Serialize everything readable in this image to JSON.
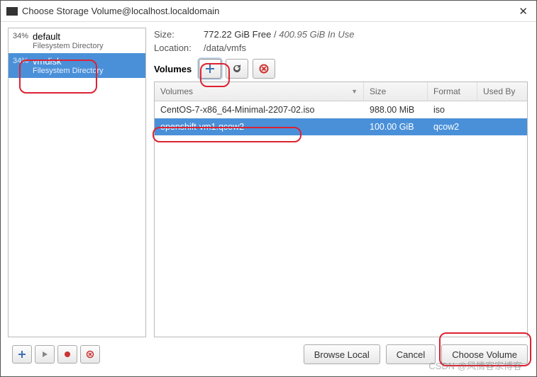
{
  "window": {
    "title": "Choose Storage Volume@localhost.localdomain"
  },
  "pools": [
    {
      "pct": "34%",
      "name": "default",
      "type": "Filesystem Directory"
    },
    {
      "pct": "34%",
      "name": "vmdisk",
      "type": "Filesystem Directory"
    }
  ],
  "info": {
    "size_label": "Size:",
    "size_free": "772.22 GiB Free",
    "size_sep": " / ",
    "size_inuse": "400.95 GiB In Use",
    "location_label": "Location:",
    "location": "/data/vmfs",
    "volumes_label": "Volumes"
  },
  "table": {
    "headers": {
      "name": "Volumes",
      "size": "Size",
      "format": "Format",
      "used": "Used By"
    },
    "rows": [
      {
        "name": "CentOS-7-x86_64-Minimal-2207-02.iso",
        "size": "988.00 MiB",
        "format": "iso",
        "used": ""
      },
      {
        "name": "openshift-vm1.qcow2",
        "size": "100.00 GiB",
        "format": "qcow2",
        "used": ""
      }
    ]
  },
  "buttons": {
    "browse": "Browse Local",
    "cancel": "Cancel",
    "choose": "Choose Volume"
  },
  "icons": {
    "add": "plus",
    "refresh": "refresh",
    "delete": "delete",
    "play": "play",
    "record": "record",
    "cancel_small": "cancel"
  },
  "watermark": "CSDN @风情客家博客"
}
